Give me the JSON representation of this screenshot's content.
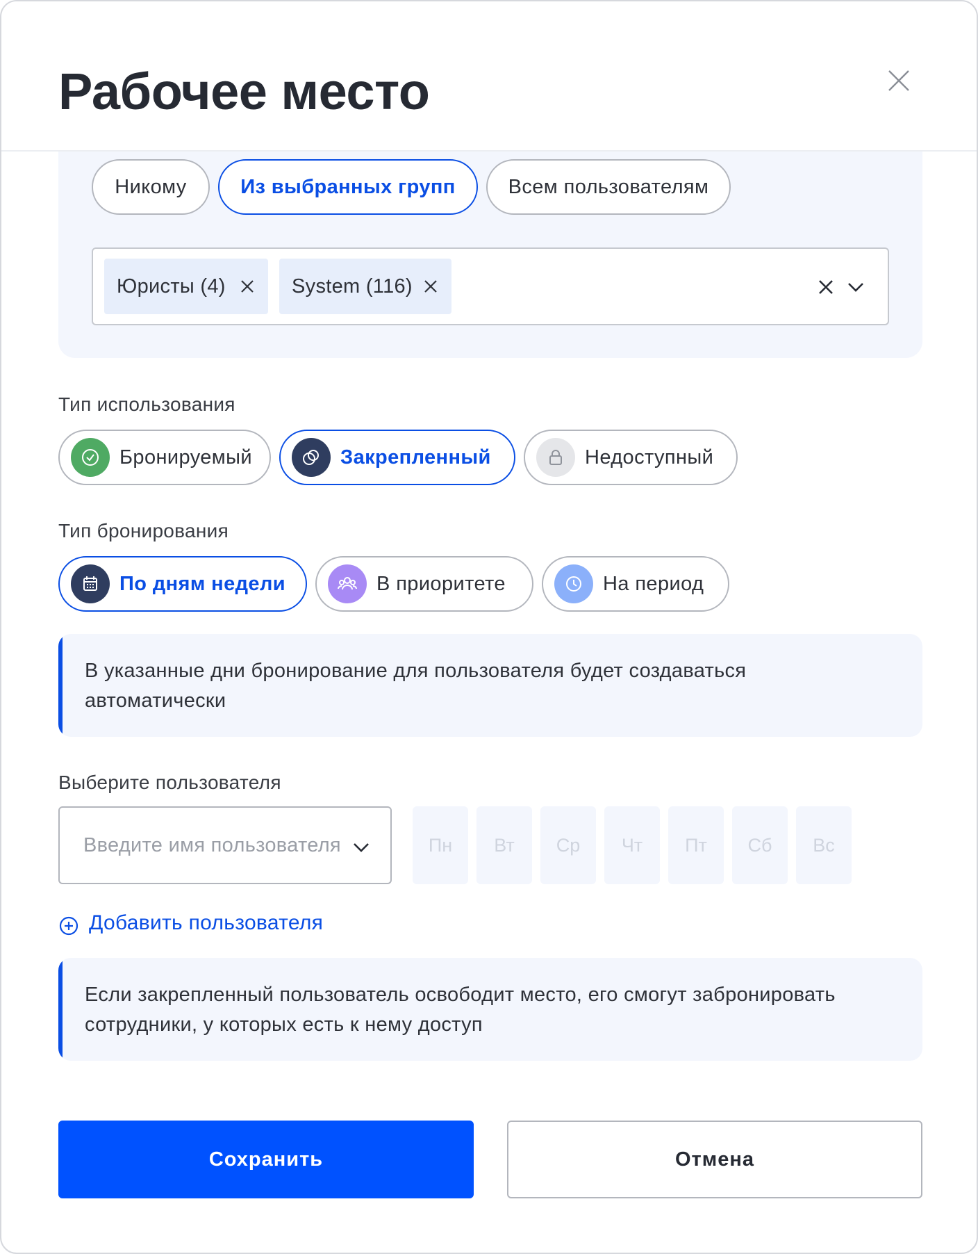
{
  "header": {
    "title": "Рабочее место"
  },
  "access": {
    "options": [
      {
        "label": "Никому",
        "active": false
      },
      {
        "label": "Из выбранных групп",
        "active": true
      },
      {
        "label": "Всем пользователям",
        "active": false
      }
    ],
    "selected_groups": [
      "Юристы (4)",
      "System (116)"
    ]
  },
  "usage_type": {
    "label": "Тип использования",
    "options": [
      {
        "label": "Бронируемый",
        "icon": "check-circle-icon",
        "icon_bg": "#4faa63",
        "active": false
      },
      {
        "label": "Закрепленный",
        "icon": "pin-icon",
        "icon_bg": "#2f3d5f",
        "active": true
      },
      {
        "label": "Недоступный",
        "icon": "lock-icon",
        "icon_bg": "#e5e6e9",
        "active": false
      }
    ]
  },
  "booking_type": {
    "label": "Тип бронирования",
    "options": [
      {
        "label": "По дням недели",
        "icon": "calendar-icon",
        "icon_bg": "#2f3d5f",
        "active": true
      },
      {
        "label": "В приоритете",
        "icon": "users-group-icon",
        "icon_bg": "#a88af5",
        "active": false
      },
      {
        "label": "На период",
        "icon": "clock-icon",
        "icon_bg": "#8bb0fa",
        "active": false
      }
    ]
  },
  "info_weekdays": "В указанные дни бронирование для пользователя будет создаваться автоматически",
  "user": {
    "label": "Выберите пользователя",
    "placeholder": "Введите имя пользователя",
    "days": [
      "Пн",
      "Вт",
      "Ср",
      "Чт",
      "Пт",
      "Сб",
      "Вс"
    ]
  },
  "add_user_label": "Добавить пользователя",
  "info_release": "Если закрепленный пользователь освободит место, его смогут забронировать сотрудники, у которых есть к нему доступ",
  "actions": {
    "save": "Сохранить",
    "cancel": "Отмена"
  },
  "colors": {
    "accent": "#0a4ee4",
    "primary_button": "#0052ff",
    "panel_bg": "#f3f6fd"
  }
}
